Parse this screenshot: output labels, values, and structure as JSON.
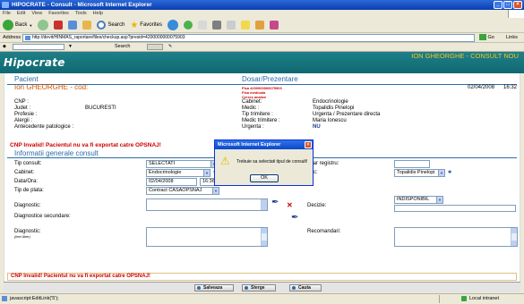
{
  "window": {
    "title": "HIPOCRATE - Consult - Microsoft Internet Explorer"
  },
  "menu": [
    "File",
    "Edit",
    "View",
    "Favorites",
    "Tools",
    "Help"
  ],
  "toolbar": {
    "back": "Back",
    "search": "Search",
    "favorites": "Favorites"
  },
  "address": {
    "label": "Address",
    "url": "http://devit/HINMAS_raportare/files/checkup.asp?presid=4200000000075903",
    "go": "Go",
    "links": "Links"
  },
  "linksbar": {
    "search": "Search"
  },
  "app": {
    "logo": "Hipocrate",
    "user": "ION GHEORGHE - CONSULT NOU"
  },
  "patient": {
    "header": "Pacient",
    "name": "Ion GHEORGHE - cod:",
    "fields": [
      {
        "label": "CNP :",
        "value": ""
      },
      {
        "label": "Judet :",
        "value": "BUCURESTI"
      },
      {
        "label": "Profesie :",
        "value": ""
      },
      {
        "label": "Alergii :",
        "value": ""
      },
      {
        "label": "Antecedente patologice :",
        "value": ""
      }
    ]
  },
  "dosar": {
    "header": "Dosar/Prezentare",
    "fisa": "Fisa 4200000000075903",
    "fisa_medicala": "Fisa medicala",
    "cerere": "Cerere analize",
    "date": "02/04/2008",
    "time": "16:32",
    "fields": [
      {
        "label": "Cabinet:",
        "value": "Endocrinologie"
      },
      {
        "label": "Medic :",
        "value": "Topalidis Pinelopi"
      },
      {
        "label": "Tip trimitere :",
        "value": "Urgenta / Prezentare directa"
      },
      {
        "label": "Medic trimitere :",
        "value": "Maria Ionescu"
      },
      {
        "label": "Urgenta :",
        "value": "NU"
      }
    ]
  },
  "warning": "CNP Invalid! Pacientul nu va fi exportat catre OPSNAJ!",
  "consult": {
    "header": "Informatii generale consult",
    "tip_consult_label": "Tip consult:",
    "tip_consult_value": "SELECTATI",
    "cabinet_label": "Cabinet:",
    "cabinet_value": "Endocrinologie",
    "data_label": "Data/Ora:",
    "data_value": "02/04/2008",
    "ora_value": "16:36",
    "tip_plata_label": "Tip de plata:",
    "tip_plata_value": "Contract CASAOPSNAJ",
    "registru_label": "Numar registru:",
    "medic_label": "Medic:",
    "medic_value": "Topalidis Pinelopi",
    "diagnostic_label": "Diagnostic:",
    "decizie_label": "Decizie:",
    "decizie_value": "INDISPONIBIL",
    "diag_sec_label": "Diagnostice secundare:",
    "diagnostic2_label": "Diagnostic:",
    "diagnostic2_sub": "(text liber)",
    "recomandari_label": "Recomandari:"
  },
  "actions": {
    "save": "Salveaza",
    "delete": "Sterge",
    "search": "Cauta"
  },
  "dialog": {
    "title": "Microsoft Internet Explorer",
    "message": "Trebuie sa selectati tipul de consult!",
    "ok": "OK"
  },
  "status": {
    "left": "javascript:EditLink('5');",
    "zone": "Local intranet"
  },
  "colors": {
    "titlebar": "#0a3fb0",
    "banner": "#0f6871",
    "user_text": "#f7c520",
    "section_header": "#2b6ca8",
    "warning": "#cc0000"
  }
}
